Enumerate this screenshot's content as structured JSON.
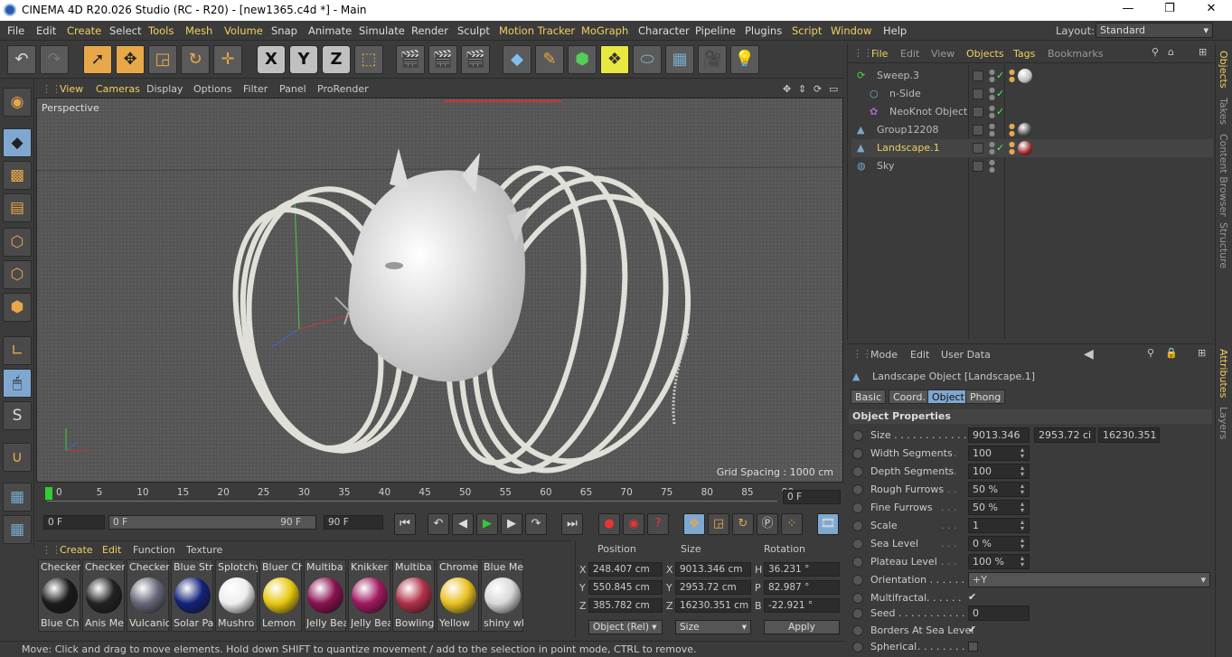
{
  "title": "CINEMA 4D R20.026 Studio (RC - R20) - [new1365.c4d *] - Main",
  "menus": [
    "File",
    "Edit",
    "Create",
    "Select",
    "Tools",
    "Mesh",
    "Volume",
    "Snap",
    "Animate",
    "Simulate",
    "Render",
    "Sculpt",
    "Motion Tracker",
    "MoGraph",
    "Character",
    "Pipeline",
    "Plugins",
    "Script",
    "Window",
    "Help"
  ],
  "layout_label": "Layout:",
  "layout_value": "Standard",
  "viewport": {
    "menus": [
      "View",
      "Cameras",
      "Display",
      "Options",
      "Filter",
      "Panel",
      "ProRender"
    ],
    "name": "Perspective",
    "grid": "Grid Spacing : 1000 cm"
  },
  "timeline": {
    "ticks": [
      "0",
      "5",
      "10",
      "15",
      "20",
      "25",
      "30",
      "35",
      "40",
      "45",
      "50",
      "55",
      "60",
      "65",
      "70",
      "75",
      "80",
      "85",
      "90"
    ],
    "frame": "0 F",
    "start": "0 F",
    "range_start": "0 F",
    "range_end": "90 F",
    "end": "90 F"
  },
  "materials": {
    "menus": [
      "Create",
      "Edit",
      "Function",
      "Texture"
    ],
    "items": [
      {
        "top": "Checker",
        "bottom": "Blue Ch",
        "color": "#1a1a1a"
      },
      {
        "top": "Checker",
        "bottom": "Anis Me",
        "color": "#222"
      },
      {
        "top": "Checker",
        "bottom": "Vulcanic",
        "color": "#667"
      },
      {
        "top": "Blue Str",
        "bottom": "Solar Pa",
        "color": "#13227a"
      },
      {
        "top": "Splotchy",
        "bottom": "Mushro",
        "color": "#eeeeee"
      },
      {
        "top": "Bluer Ch",
        "bottom": "Lemon",
        "color": "#e8c810"
      },
      {
        "top": "Multiba",
        "bottom": "Jelly Bea",
        "color": "#8a1050"
      },
      {
        "top": "Knikker",
        "bottom": "Jelly Bea",
        "color": "#a01860"
      },
      {
        "top": "Multiba",
        "bottom": "Bowling",
        "color": "#b03048"
      },
      {
        "top": "Chrome",
        "bottom": "Yellow",
        "color": "#e8c020"
      },
      {
        "top": "Blue Me",
        "bottom": "shiny wl",
        "color": "#d8d8d8"
      }
    ]
  },
  "coords": {
    "headers": [
      "Position",
      "Size",
      "Rotation"
    ],
    "rows": [
      {
        "a": "X",
        "p": "248.407 cm",
        "b": "X",
        "s": "9013.346 cm",
        "c": "H",
        "r": "36.231 °"
      },
      {
        "a": "Y",
        "p": "550.845 cm",
        "b": "Y",
        "s": "2953.72 cm",
        "c": "P",
        "r": "82.987 °"
      },
      {
        "a": "Z",
        "p": "385.782 cm",
        "b": "Z",
        "s": "16230.351 cm",
        "c": "B",
        "r": "-22.921 °"
      }
    ],
    "mode": "Object (Rel)",
    "size_mode": "Size",
    "apply": "Apply"
  },
  "status": "Move: Click and drag to move elements. Hold down SHIFT to quantize movement / add to the selection in point mode, CTRL to remove.",
  "objects": {
    "menus": [
      "File",
      "Edit",
      "View",
      "Objects",
      "Tags",
      "Bookmarks"
    ],
    "items": [
      {
        "name": "Sweep.3",
        "indent": 0,
        "color": "#bbb"
      },
      {
        "name": "n-Side",
        "indent": 1,
        "color": "#bbb"
      },
      {
        "name": "NeoKnot Object",
        "indent": 1,
        "color": "#bbb"
      },
      {
        "name": "Group12208",
        "indent": 0,
        "color": "#bbb"
      },
      {
        "name": "Landscape.1",
        "indent": 0,
        "color": "#f0d060"
      },
      {
        "name": "Sky",
        "indent": 0,
        "color": "#bbb"
      }
    ]
  },
  "attributes": {
    "menus": [
      "Mode",
      "Edit",
      "User Data"
    ],
    "object_title": "Landscape Object [Landscape.1]",
    "tabs": [
      "Basic",
      "Coord.",
      "Object",
      "Phong"
    ],
    "section": "Object Properties",
    "size": [
      "9013.346",
      "2953.72 ci",
      "16230.351"
    ],
    "props": [
      {
        "label": "Width Segments",
        "value": "100"
      },
      {
        "label": "Depth Segments",
        "value": "100"
      },
      {
        "label": "Rough Furrows",
        "value": "50 %"
      },
      {
        "label": "Fine Furrows",
        "value": "50 %"
      },
      {
        "label": "Scale",
        "value": "1"
      },
      {
        "label": "Sea Level",
        "value": "0 %"
      },
      {
        "label": "Plateau Level",
        "value": "100 %"
      }
    ],
    "orientation": "+Y",
    "multifractal": "Multifractal",
    "seed": "0",
    "borders": "Borders At Sea Level",
    "spherical": "Spherical"
  },
  "side_tabs": [
    "Objects",
    "Takes",
    "Content Browser",
    "Structure",
    "Attributes",
    "Layers"
  ]
}
